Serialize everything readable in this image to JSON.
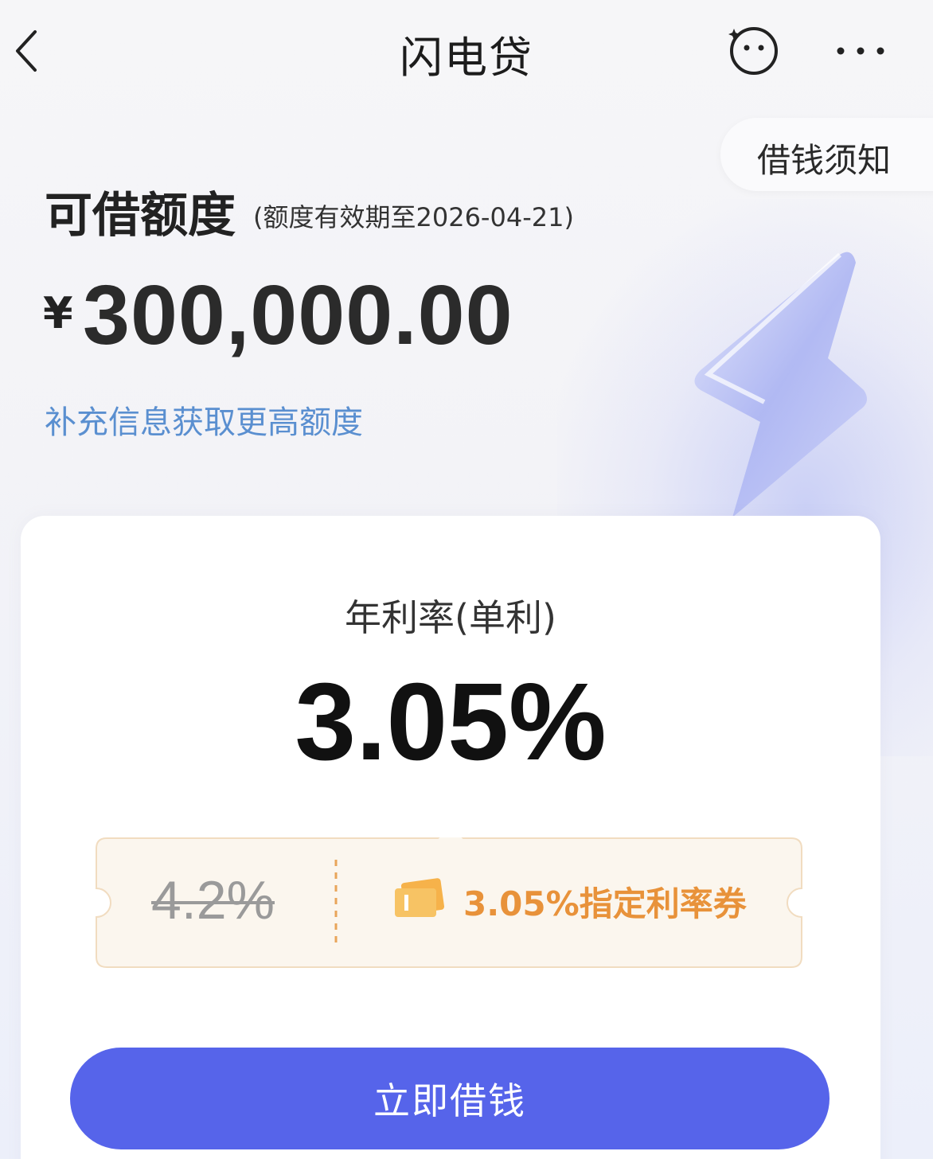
{
  "header": {
    "title": "闪电贷",
    "back_icon": "chevron-left-icon",
    "assistant_icon": "smiley-bot-icon",
    "more_icon": "ellipsis-icon"
  },
  "notice": {
    "label": "借钱须知"
  },
  "limit": {
    "label": "可借额度",
    "validity": "(额度有效期至2026-04-21)",
    "currency": "¥",
    "amount": "300,000.00",
    "raise_link": "补充信息获取更高额度"
  },
  "rate": {
    "label": "年利率(单利)",
    "value": "3.05%"
  },
  "coupon": {
    "original_rate": "4.2%",
    "description": "3.05%指定利率券",
    "accent_color": "#e8923a"
  },
  "action": {
    "borrow_label": "立即借钱",
    "button_color": "#5664ea"
  }
}
